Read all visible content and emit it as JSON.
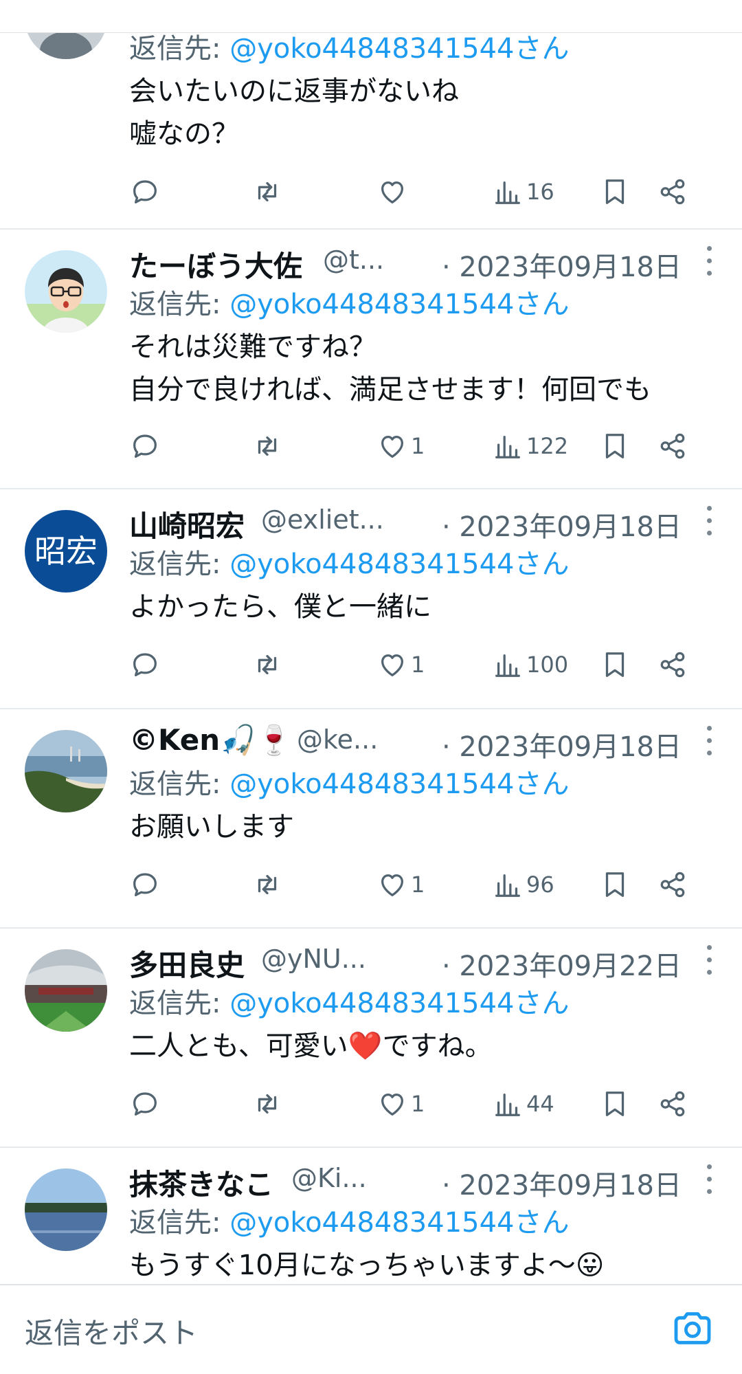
{
  "tweets": [
    {
      "name": "",
      "handle": "",
      "date": "",
      "reply_prefix": "返信先:",
      "reply_mention": "@yoko44848341544さん",
      "lines": [
        "会いたいのに返事がないね",
        "嘘なの？"
      ],
      "likes": "",
      "views": "16",
      "avatar": "default-avatar"
    },
    {
      "name": "たーぼう大佐",
      "handle": "@t...",
      "date": "· 2023年09月18日",
      "reply_prefix": "返信先:",
      "reply_mention": "@yoko44848341544さん",
      "lines": [
        "それは災難ですね？",
        "自分で良ければ、満足させます！何回でも"
      ],
      "likes": "1",
      "views": "122",
      "avatar": "cartoon-glasses-avatar"
    },
    {
      "name": "山崎昭宏",
      "handle": "@exliet...",
      "date": "· 2023年09月18日",
      "reply_prefix": "返信先:",
      "reply_mention": "@yoko44848341544さん",
      "lines": [
        "よかったら、僕と一緒に"
      ],
      "likes": "1",
      "views": "100",
      "avatar": "initials-avatar",
      "avatar_text": "昭宏"
    },
    {
      "name": "©Ken🎣🍷",
      "handle": "@ke...",
      "date": "· 2023年09月18日",
      "reply_prefix": "返信先:",
      "reply_mention": "@yoko44848341544さん",
      "lines": [
        "お願いします"
      ],
      "likes": "1",
      "views": "96",
      "avatar": "coast-photo-avatar"
    },
    {
      "name": "多田良史",
      "handle": "@yNU...",
      "date": "· 2023年09月22日",
      "reply_prefix": "返信先:",
      "reply_mention": "@yoko44848341544さん",
      "lines": [
        "二人とも、可愛い❤️ですね。"
      ],
      "likes": "1",
      "views": "44",
      "avatar": "stadium-photo-avatar"
    },
    {
      "name": "抹茶きなこ",
      "handle": "@Ki...",
      "date": "· 2023年09月18日",
      "reply_prefix": "返信先:",
      "reply_mention": "@yoko44848341544さん",
      "lines": [
        "もうすぐ10月になっちゃいますよ〜😛"
      ],
      "likes": "",
      "views": "",
      "avatar": "lake-photo-avatar"
    }
  ],
  "composer": {
    "placeholder": "返信をポスト",
    "camera_icon": "camera-icon"
  },
  "colors": {
    "link": "#1d9bf0",
    "secondary_text": "#536471",
    "avatar_blue": "#0a4d96"
  }
}
